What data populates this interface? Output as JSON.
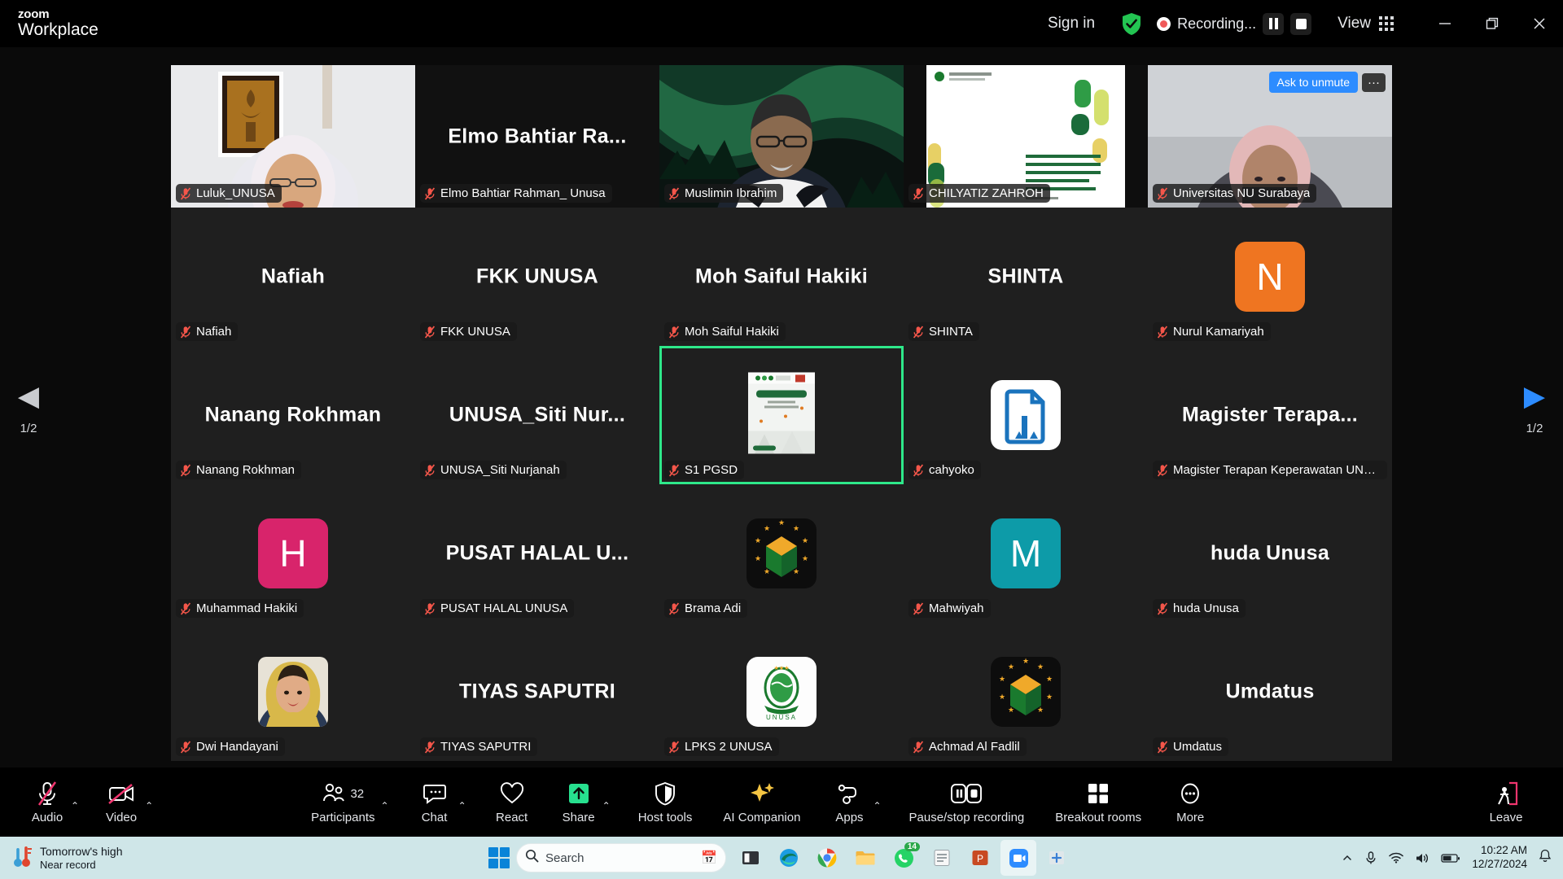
{
  "titlebar": {
    "brand_line1": "zoom",
    "brand_line2": "Workplace",
    "sign_in": "Sign in",
    "encryption_icon": "shield-check-icon",
    "recording_label": "Recording...",
    "pause_recording_icon": "pause-icon",
    "stop_recording_icon": "stop-icon",
    "view_label": "View",
    "view_icon": "grid-view-icon",
    "minimize_icon": "minimize-icon",
    "restore_icon": "restore-icon",
    "close_icon": "close-icon"
  },
  "gallery": {
    "prev_arrow_icon": "chevron-left-icon",
    "next_arrow_icon": "chevron-right-icon",
    "page_left": "1/2",
    "page_right": "1/2",
    "ask_to_unmute": "Ask to unmute",
    "more_options": "···",
    "rows": [
      {
        "type": "video",
        "tiles": [
          {
            "name": "Luluk_UNUSA",
            "display": "",
            "kind": "video",
            "muted": true
          },
          {
            "name": "Elmo Bahtiar Rahman_ Unusa",
            "display": "Elmo  Bahtiar  Ra...",
            "kind": "name",
            "muted": true
          },
          {
            "name": "Muslimin Ibrahim",
            "display": "",
            "kind": "video",
            "muted": true
          },
          {
            "name": "CHILYATIZ ZAHROH",
            "display": "",
            "kind": "video",
            "muted": true
          },
          {
            "name": "Universitas NU Surabaya",
            "display": "",
            "kind": "video",
            "muted": true,
            "ask_unmute": true
          }
        ]
      },
      {
        "type": "name",
        "tiles": [
          {
            "name": "Nafiah",
            "display": "Nafiah",
            "kind": "name",
            "muted": true
          },
          {
            "name": "FKK UNUSA",
            "display": "FKK UNUSA",
            "kind": "name",
            "muted": true
          },
          {
            "name": "Moh Saiful Hakiki",
            "display": "Moh Saiful Hakiki",
            "kind": "name",
            "muted": true
          },
          {
            "name": "SHINTA",
            "display": "SHINTA",
            "kind": "name",
            "muted": true
          },
          {
            "name": "Nurul Kamariyah",
            "display": "",
            "kind": "avatar",
            "initial": "N",
            "color": "#ef7521",
            "muted": true
          }
        ]
      },
      {
        "type": "name",
        "tiles": [
          {
            "name": "Nanang Rokhman",
            "display": "Nanang Rokhman",
            "kind": "name",
            "muted": true
          },
          {
            "name": "UNUSA_Siti Nurjanah",
            "display": "UNUSA_Siti  Nur...",
            "kind": "name",
            "muted": true
          },
          {
            "name": "S1 PGSD",
            "display": "",
            "kind": "poster",
            "muted": true,
            "active": true
          },
          {
            "name": "cahyoko",
            "display": "",
            "kind": "doc-logo",
            "muted": true
          },
          {
            "name": "Magister Terapan Keperawatan UNU...",
            "display": "Magister  Terapa...",
            "kind": "name",
            "muted": true
          }
        ]
      },
      {
        "type": "name",
        "tiles": [
          {
            "name": "Muhammad Hakiki",
            "display": "",
            "kind": "avatar",
            "initial": "H",
            "color": "#d8246b",
            "muted": true
          },
          {
            "name": "PUSAT HALAL UNUSA",
            "display": "PUSAT HALAL U...",
            "kind": "name",
            "muted": true
          },
          {
            "name": "Brama Adi",
            "display": "",
            "kind": "unusa-logo",
            "muted": true
          },
          {
            "name": "Mahwiyah",
            "display": "",
            "kind": "avatar",
            "initial": "M",
            "color": "#0d9ba8",
            "muted": true
          },
          {
            "name": "huda Unusa",
            "display": "huda Unusa",
            "kind": "name",
            "muted": true
          }
        ]
      },
      {
        "type": "name",
        "tiles": [
          {
            "name": "Dwi Handayani",
            "display": "",
            "kind": "photo",
            "muted": true
          },
          {
            "name": "TIYAS SAPUTRI",
            "display": "TIYAS SAPUTRI",
            "kind": "name",
            "muted": true
          },
          {
            "name": "LPKS 2 UNUSA",
            "display": "",
            "kind": "lpks-logo",
            "muted": true
          },
          {
            "name": "Achmad Al Fadlil",
            "display": "",
            "kind": "unusa-logo-dark",
            "muted": true
          },
          {
            "name": "Umdatus",
            "display": "Umdatus",
            "kind": "name",
            "muted": true
          }
        ]
      }
    ]
  },
  "toolbar": {
    "items": [
      {
        "label": "Audio",
        "icon": "microphone-muted-icon",
        "caret": true
      },
      {
        "label": "Video",
        "icon": "camera-muted-icon",
        "caret": true
      },
      {
        "label": "Participants",
        "icon": "participants-icon",
        "count": "32",
        "caret": true
      },
      {
        "label": "Chat",
        "icon": "chat-icon",
        "caret": true
      },
      {
        "label": "React",
        "icon": "heart-icon",
        "caret": false
      },
      {
        "label": "Share",
        "icon": "share-screen-icon",
        "caret": true
      },
      {
        "label": "Host tools",
        "icon": "shield-host-icon",
        "caret": false
      },
      {
        "label": "AI Companion",
        "icon": "sparkle-icon",
        "caret": false
      },
      {
        "label": "Apps",
        "icon": "apps-icon",
        "caret": true
      },
      {
        "label": "Pause/stop recording",
        "icon": "pause-stop-recording-icon",
        "caret": false
      },
      {
        "label": "Breakout rooms",
        "icon": "breakout-rooms-icon",
        "caret": false
      },
      {
        "label": "More",
        "icon": "more-dots-icon",
        "caret": false
      }
    ],
    "leave_label": "Leave",
    "leave_icon": "leave-door-icon"
  },
  "taskbar": {
    "weather_title": "Tomorrow's high",
    "weather_sub": "Near record",
    "weather_icon": "thermometer-icon",
    "start_icon": "windows-start-icon",
    "search_placeholder": "Search",
    "search_icon": "search-icon",
    "apps": [
      {
        "name": "task-view-icon",
        "badge": ""
      },
      {
        "name": "edge-icon",
        "badge": ""
      },
      {
        "name": "chrome-icon",
        "badge": ""
      },
      {
        "name": "file-explorer-icon",
        "badge": ""
      },
      {
        "name": "whatsapp-icon",
        "badge": "14"
      },
      {
        "name": "notepad-icon",
        "badge": ""
      },
      {
        "name": "powerpoint-icon",
        "badge": ""
      },
      {
        "name": "zoom-icon",
        "badge": ""
      },
      {
        "name": "store-icon",
        "badge": ""
      }
    ],
    "tray_expand_icon": "chevron-up-icon",
    "mic_icon": "mic-tray-icon",
    "wifi_icon": "wifi-icon",
    "volume_icon": "volume-icon",
    "battery_icon": "battery-icon",
    "time": "10:22 AM",
    "date": "12/27/2024",
    "notification_icon": "bell-icon"
  }
}
